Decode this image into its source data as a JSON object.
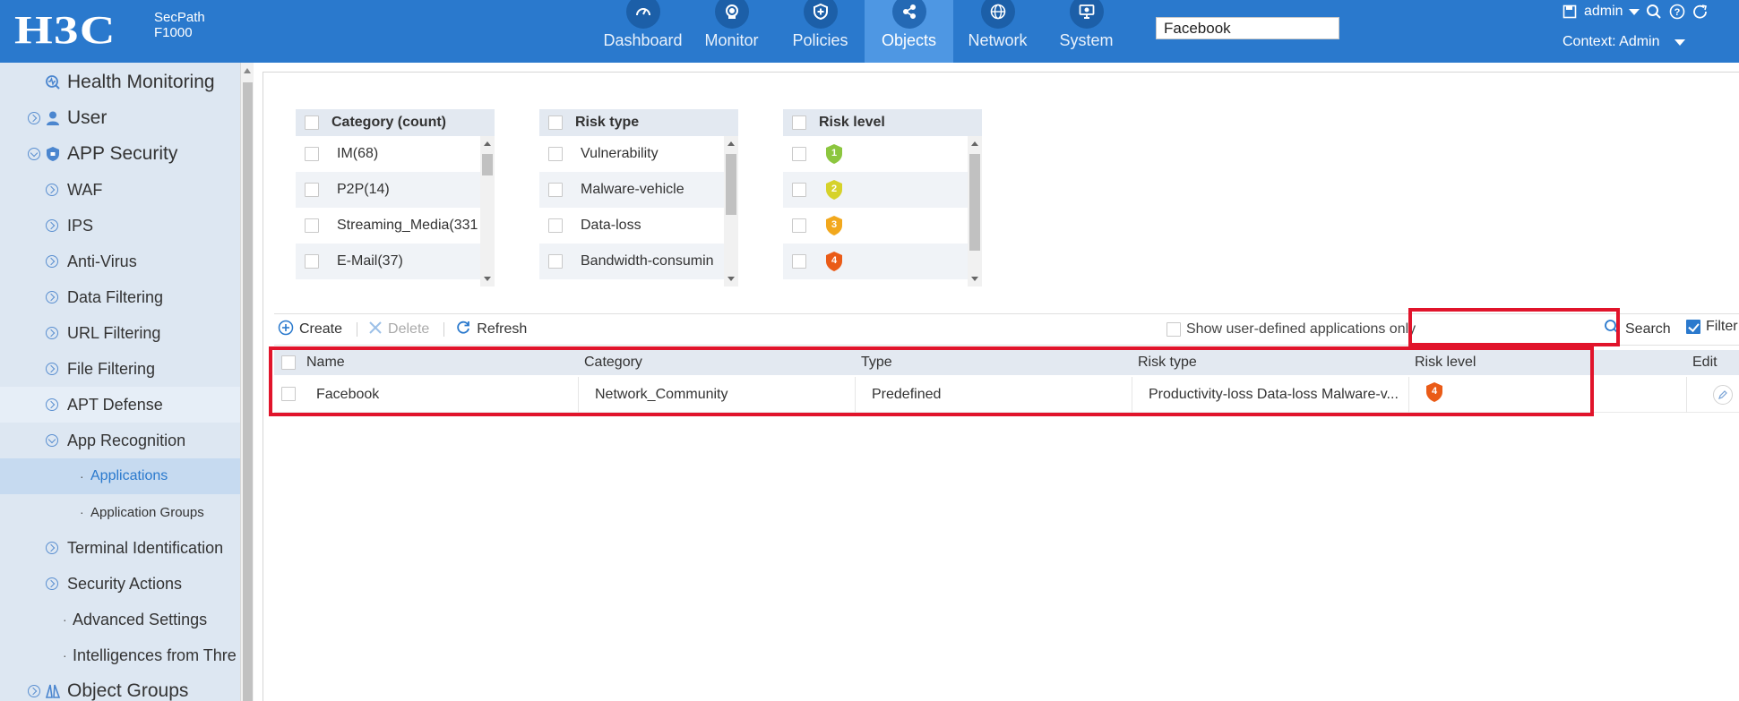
{
  "header": {
    "logo": "H3C",
    "model_line1": "SecPath",
    "model_line2": "F1000",
    "nav": [
      {
        "label": "Dashboard",
        "icon": "gauge-icon"
      },
      {
        "label": "Monitor",
        "icon": "camera-icon"
      },
      {
        "label": "Policies",
        "icon": "shield-plus-icon"
      },
      {
        "label": "Objects",
        "icon": "share-nodes-icon"
      },
      {
        "label": "Network",
        "icon": "globe-icon"
      },
      {
        "label": "System",
        "icon": "monitor-gear-icon"
      }
    ],
    "active_nav": "Objects",
    "user": "admin",
    "context": "Context: Admin"
  },
  "sidebar": {
    "items": [
      {
        "label": "Health Monitoring",
        "level": 0,
        "icon": "health-monitor-icon"
      },
      {
        "label": "User",
        "level": 0,
        "icon": "user-icon"
      },
      {
        "label": "APP Security",
        "level": 0,
        "icon": "shield-icon"
      },
      {
        "label": "WAF",
        "level": 1
      },
      {
        "label": "IPS",
        "level": 1
      },
      {
        "label": "Anti-Virus",
        "level": 1
      },
      {
        "label": "Data Filtering",
        "level": 1
      },
      {
        "label": "URL Filtering",
        "level": 1
      },
      {
        "label": "File Filtering",
        "level": 1
      },
      {
        "label": "APT Defense",
        "level": 1
      },
      {
        "label": "App Recognition",
        "level": 1
      },
      {
        "label": "Applications",
        "level": 2
      },
      {
        "label": "Application Groups",
        "level": 2
      },
      {
        "label": "Terminal Identification",
        "level": 1
      },
      {
        "label": "Security Actions",
        "level": 1
      },
      {
        "label": "Advanced Settings",
        "level": 2
      },
      {
        "label": "Intelligences from Thre",
        "level": 2
      },
      {
        "label": "Object Groups",
        "level": 0,
        "icon": "object-groups-icon"
      }
    ],
    "selected": "Applications"
  },
  "filters": {
    "category": {
      "header": "Category (count)",
      "rows": [
        "IM(68)",
        "P2P(14)",
        "Streaming_Media(331",
        "E-Mail(37)"
      ]
    },
    "risk_type": {
      "header": "Risk type",
      "rows": [
        "Vulnerability",
        "Malware-vehicle",
        "Data-loss",
        "Bandwidth-consumin"
      ]
    },
    "risk_level": {
      "header": "Risk level",
      "rows": [
        {
          "level": "1",
          "color": "#8cc63f"
        },
        {
          "level": "2",
          "color": "#d6d22a"
        },
        {
          "level": "3",
          "color": "#f2a81d"
        },
        {
          "level": "4",
          "color": "#ea5b17"
        }
      ]
    }
  },
  "toolbar": {
    "create": "Create",
    "delete": "Delete",
    "refresh": "Refresh",
    "show_user_defined": "Show user-defined applications only",
    "search_value": "Facebook",
    "search": "Search",
    "filter": "Filter"
  },
  "table": {
    "columns": [
      "Name",
      "Category",
      "Type",
      "Risk type",
      "Risk level",
      "Edit"
    ],
    "rows": [
      {
        "name": "Facebook",
        "category": "Network_Community",
        "type": "Predefined",
        "risk_type": "Productivity-loss Data-loss Malware-v...",
        "risk_level": "4",
        "risk_color": "#ea5b17"
      }
    ]
  },
  "colors": {
    "header_bg": "#2a79cd",
    "highlight": "#e1142b"
  }
}
